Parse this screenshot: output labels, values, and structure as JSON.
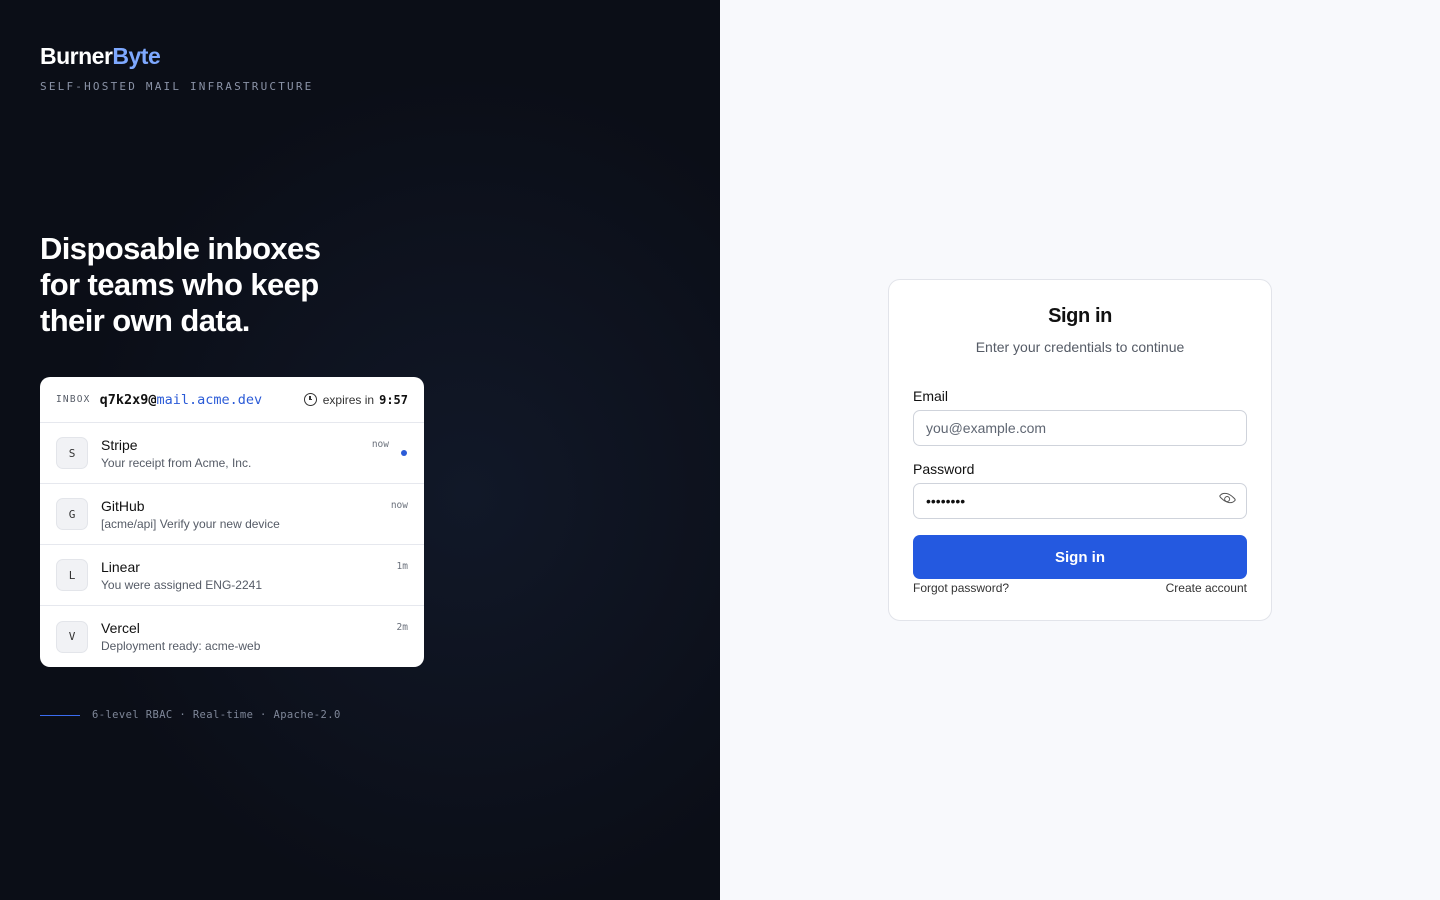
{
  "brand": {
    "name_primary": "Burner",
    "name_accent": "Byte",
    "tagline": "SELF-HOSTED MAIL INFRASTRUCTURE"
  },
  "hero": {
    "line1": "Disposable inboxes",
    "line2": "for teams who keep",
    "line3": "their own data."
  },
  "inbox": {
    "label": "INBOX",
    "address_local": "q7k2x9@",
    "address_domain": "mail.acme.dev",
    "expires_label": "expires in",
    "expires_value": "9:57",
    "messages": [
      {
        "initial": "S",
        "sender": "Stripe",
        "subject": "Your receipt from Acme, Inc.",
        "time": "now",
        "unread": true
      },
      {
        "initial": "G",
        "sender": "GitHub",
        "subject": "[acme/api] Verify your new device",
        "time": "now",
        "unread": false
      },
      {
        "initial": "L",
        "sender": "Linear",
        "subject": "You were assigned ENG-2241",
        "time": "1m",
        "unread": false
      },
      {
        "initial": "V",
        "sender": "Vercel",
        "subject": "Deployment ready: acme-web",
        "time": "2m",
        "unread": false
      }
    ]
  },
  "footer": {
    "text": "6-level RBAC · Real-time · Apache-2.0"
  },
  "signin": {
    "title": "Sign in",
    "subtitle": "Enter your credentials to continue",
    "email_label": "Email",
    "email_placeholder": "you@example.com",
    "email_value": "",
    "password_label": "Password",
    "password_value": "••••••••",
    "submit_label": "Sign in",
    "forgot_label": "Forgot password?",
    "create_label": "Create account"
  },
  "colors": {
    "accent": "#2459e0",
    "brand_accent": "#7ea8ff",
    "left_bg": "#0b0e17",
    "right_bg": "#f8f9fc"
  },
  "icons": {
    "clock": "clock-icon",
    "eye": "eye-icon"
  }
}
